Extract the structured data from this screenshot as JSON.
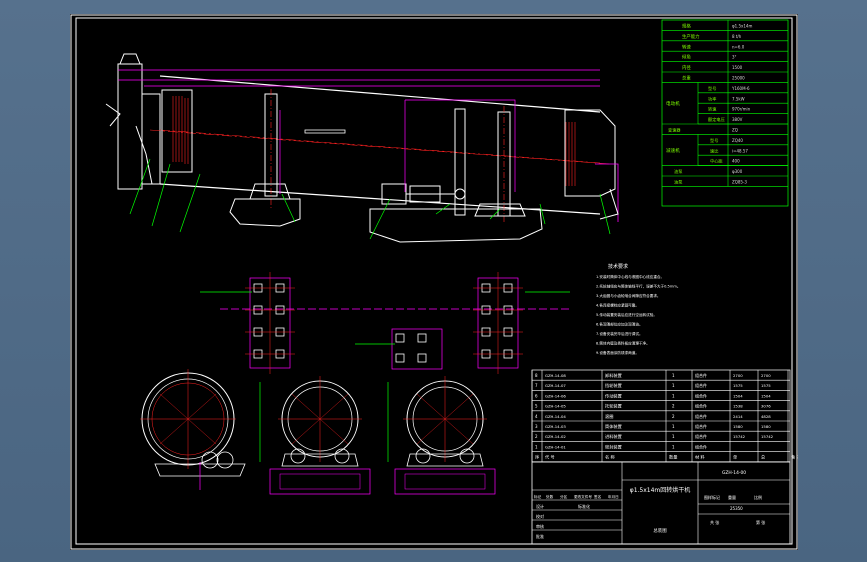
{
  "specs": {
    "rows": [
      {
        "label": "规格",
        "value": "φ1.5x14m"
      },
      {
        "label": "生产能力",
        "value": "8 t/h"
      },
      {
        "label": "转速",
        "value": "n=6.0"
      },
      {
        "label": "倾角",
        "value": "3°"
      },
      {
        "label": "内径",
        "value": "1500"
      },
      {
        "label": "总重",
        "value": "25000"
      }
    ],
    "motor_group": "电动机",
    "motor_rows": [
      {
        "label": "型号",
        "value": "Y160M-6"
      },
      {
        "label": "功率",
        "value": "7.5kW"
      },
      {
        "label": "转速",
        "value": "970r/min"
      },
      {
        "label": "额定电压",
        "value": "380V"
      }
    ],
    "misc_row": {
      "label": "变速器",
      "value": "ZQ"
    },
    "reducer_group": "减速机",
    "reducer_rows": [
      {
        "label": "型号",
        "value": "ZQ40"
      },
      {
        "label": "速比",
        "value": "i=48.57"
      },
      {
        "label": "中心距",
        "value": "400"
      }
    ],
    "pump_rows": [
      {
        "label": "油泵",
        "value": "φ300"
      },
      {
        "label": "油泵",
        "value": "ZQ85-3"
      }
    ]
  },
  "notes": {
    "title": "技术要求",
    "lines": [
      "1.安装时筒体中心线与滚圈中心线应重合。",
      "2.托轮轴线应与筒体轴线平行，误差不大于0.5mm。",
      "3.大齿圈与小齿轮啮合间隙应符合要求。",
      "4.各连接螺栓应紧固可靠。",
      "5.传动装置安装后应进行空运转试验。",
      "6.各润滑部位应加注润滑油。",
      "7.设备安装完毕后进行调试。",
      "8.筒体内壁及扬料板应清理干净。",
      "9.设备表面涂防锈漆两道。"
    ]
  },
  "parts": {
    "rows": [
      {
        "no": "8",
        "code": "GZH-14-08",
        "name": "卸料装置",
        "qty": "1",
        "mat": "组合件",
        "w1": "2700",
        "w2": "2700"
      },
      {
        "no": "7",
        "code": "GZH-14-07",
        "name": "挡轮装置",
        "qty": "1",
        "mat": "组合件",
        "w1": "1575",
        "w2": "1575"
      },
      {
        "no": "6",
        "code": "GZH-14-06",
        "name": "传动装置",
        "qty": "1",
        "mat": "组合件",
        "w1": "1504",
        "w2": "1504"
      },
      {
        "no": "5",
        "code": "GZH-14-05",
        "name": "托轮装置",
        "qty": "2",
        "mat": "组合件",
        "w1": "1538",
        "w2": "3076"
      },
      {
        "no": "4",
        "code": "GZH-14-04",
        "name": "滚圈",
        "qty": "2",
        "mat": "组合件",
        "w1": "2414",
        "w2": "4828"
      },
      {
        "no": "3",
        "code": "GZH-14-03",
        "name": "筒体装置",
        "qty": "1",
        "mat": "组合件",
        "w1": "1580",
        "w2": "1580"
      },
      {
        "no": "2",
        "code": "GZH-14-02",
        "name": "进料装置",
        "qty": "1",
        "mat": "组合件",
        "w1": "15742",
        "w2": "15742"
      },
      {
        "no": "1",
        "code": "GZH-14-01",
        "name": "密封装置",
        "qty": "1",
        "mat": "组合件",
        "w1": "",
        "w2": ""
      }
    ],
    "header": [
      "序",
      "代 号",
      "名  称",
      "数量",
      "材  料",
      "单",
      "总",
      "备 注"
    ]
  },
  "titleblock": {
    "drawing_no": "GZH-14-00",
    "title": "φ1.5x14m回转烘干机",
    "subtitle": "总装图",
    "stage_label": "图样标记",
    "weight_label": "重量",
    "scale_label": "比例",
    "weight": "25350",
    "sheet": "共 张",
    "sheet2": "第 张",
    "roles": [
      "设计",
      "校对",
      "审核",
      "批准"
    ],
    "hdr": [
      "标记",
      "处数",
      "分区",
      "更改文件号",
      "签名",
      "年月日"
    ],
    "std_label": "标准化"
  },
  "colors": {
    "background": "#4f6a86",
    "paper": "#000000",
    "frame": "#ffffff",
    "magenta": "#ff00ff",
    "green": "#00ff00",
    "red": "#ff2020",
    "yellow": "#ffff00"
  }
}
